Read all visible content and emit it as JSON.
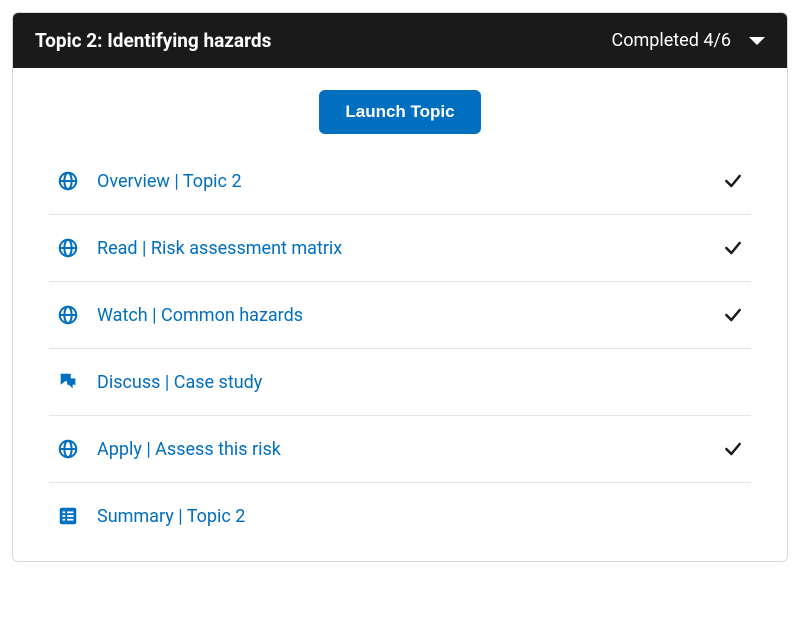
{
  "header": {
    "title": "Topic 2: Identifying hazards",
    "status": "Completed 4/6"
  },
  "actions": {
    "launch_label": "Launch Topic"
  },
  "items": [
    {
      "label": "Overview | Topic 2",
      "icon": "globe",
      "completed": true
    },
    {
      "label": "Read | Risk assessment matrix",
      "icon": "globe",
      "completed": true
    },
    {
      "label": "Watch | Common hazards",
      "icon": "globe",
      "completed": true
    },
    {
      "label": "Discuss | Case study",
      "icon": "discuss",
      "completed": false
    },
    {
      "label": "Apply | Assess this risk",
      "icon": "globe",
      "completed": true
    },
    {
      "label": "Summary | Topic 2",
      "icon": "summary",
      "completed": false
    }
  ]
}
